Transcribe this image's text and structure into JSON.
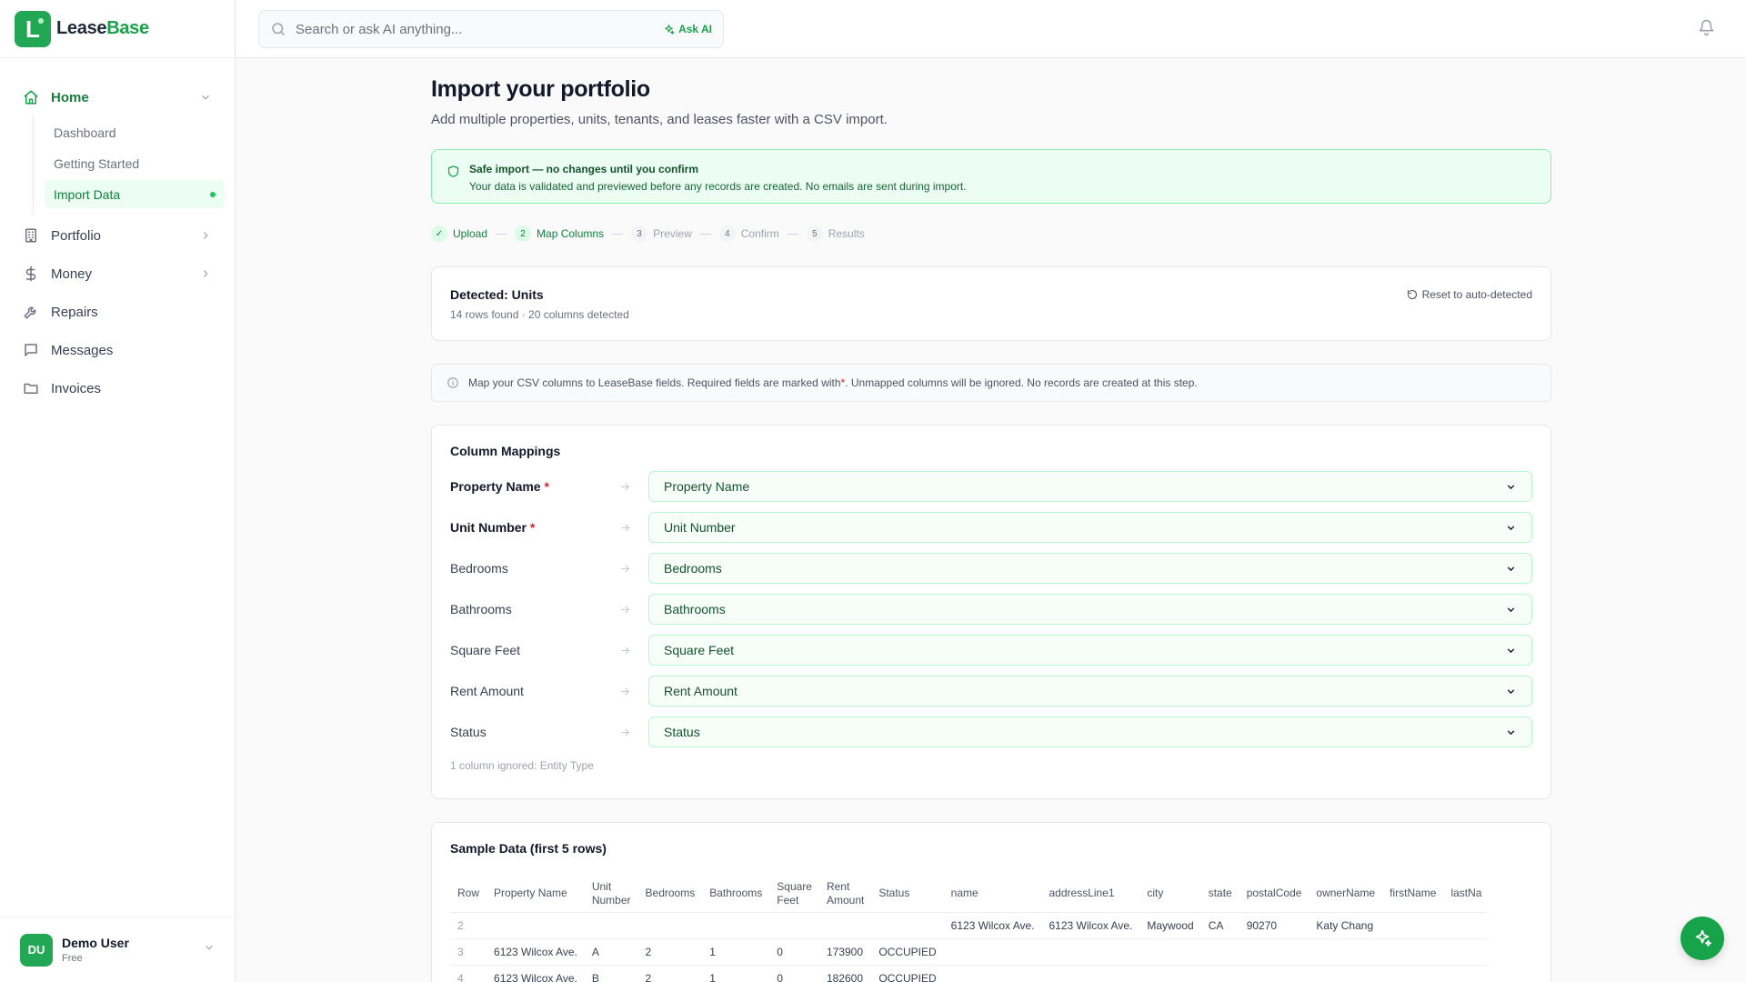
{
  "brand": {
    "name_part1": "Lease",
    "name_part2": "Base",
    "logo_letter": "L",
    "accent": "#16a34a"
  },
  "search": {
    "placeholder": "Search or ask AI anything...",
    "ask_ai_label": "Ask AI"
  },
  "sidebar": {
    "items": [
      {
        "label": "Home",
        "icon": "home-icon",
        "expanded": true,
        "children": [
          {
            "label": "Dashboard"
          },
          {
            "label": "Getting Started"
          },
          {
            "label": "Import Data",
            "active": true
          }
        ]
      },
      {
        "label": "Portfolio",
        "icon": "building-icon"
      },
      {
        "label": "Money",
        "icon": "dollar-icon"
      },
      {
        "label": "Repairs",
        "icon": "wrench-icon"
      },
      {
        "label": "Messages",
        "icon": "message-icon"
      },
      {
        "label": "Invoices",
        "icon": "folder-icon"
      }
    ]
  },
  "user": {
    "initials": "DU",
    "name": "Demo User",
    "plan": "Free"
  },
  "page": {
    "title": "Import your portfolio",
    "subtitle": "Add multiple properties, units, tenants, and leases faster with a CSV import."
  },
  "alert": {
    "title": "Safe import — no changes until you confirm",
    "body": "Your data is validated and previewed before any records are created. No emails are sent during import."
  },
  "stepper": [
    {
      "num": "✓",
      "label": "Upload",
      "state": "done"
    },
    {
      "num": "2",
      "label": "Map Columns",
      "state": "current"
    },
    {
      "num": "3",
      "label": "Preview",
      "state": "upcoming"
    },
    {
      "num": "4",
      "label": "Confirm",
      "state": "upcoming"
    },
    {
      "num": "5",
      "label": "Results",
      "state": "upcoming"
    }
  ],
  "detected": {
    "title": "Detected: Units",
    "subtitle": "14 rows found · 20 columns detected",
    "reset_label": "Reset to auto-detected"
  },
  "info": {
    "text_before": "Map your CSV columns to LeaseBase fields. Required fields are marked with ",
    "required_mark": "*",
    "text_after": ". Unmapped columns will be ignored. No records are created at this step."
  },
  "mappings": {
    "title": "Column Mappings",
    "rows": [
      {
        "label": "Property Name",
        "required": true,
        "value": "Property Name"
      },
      {
        "label": "Unit Number",
        "required": true,
        "value": "Unit Number"
      },
      {
        "label": "Bedrooms",
        "required": false,
        "value": "Bedrooms"
      },
      {
        "label": "Bathrooms",
        "required": false,
        "value": "Bathrooms"
      },
      {
        "label": "Square Feet",
        "required": false,
        "value": "Square Feet"
      },
      {
        "label": "Rent Amount",
        "required": false,
        "value": "Rent Amount"
      },
      {
        "label": "Status",
        "required": false,
        "value": "Status"
      }
    ],
    "ignored_note": "1 column ignored: Entity Type"
  },
  "sample": {
    "title": "Sample Data (first 5 rows)",
    "columns": [
      "Row",
      "Property Name",
      "Unit\nNumber",
      "Bedrooms",
      "Bathrooms",
      "Square\nFeet",
      "Rent\nAmount",
      "Status",
      "name",
      "addressLine1",
      "city",
      "state",
      "postalCode",
      "ownerName",
      "firstName",
      "lastNa"
    ],
    "rows": [
      [
        "2",
        "",
        "",
        "",
        "",
        "",
        "",
        "",
        "6123 Wilcox Ave.",
        "6123 Wilcox Ave.",
        "Maywood",
        "CA",
        "90270",
        "Katy Chang",
        "",
        ""
      ],
      [
        "3",
        "6123 Wilcox Ave.",
        "A",
        "2",
        "1",
        "0",
        "173900",
        "OCCUPIED",
        "",
        "",
        "",
        "",
        "",
        "",
        "",
        ""
      ],
      [
        "4",
        "6123 Wilcox Ave.",
        "B",
        "2",
        "1",
        "0",
        "182600",
        "OCCUPIED",
        "",
        "",
        "",
        "",
        "",
        "",
        "",
        ""
      ]
    ]
  }
}
